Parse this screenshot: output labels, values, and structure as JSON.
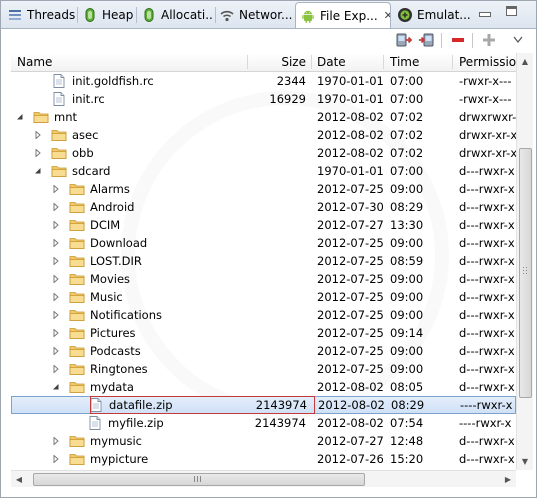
{
  "tabs": [
    {
      "label": "Threads",
      "icon": "threads-icon"
    },
    {
      "label": "Heap",
      "icon": "heap-icon"
    },
    {
      "label": "Allocati...",
      "icon": "allocation-tracker-icon"
    },
    {
      "label": "Networ...",
      "icon": "network-icon"
    },
    {
      "label": "File Exp...",
      "icon": "android-icon",
      "active": true,
      "close": "✕"
    },
    {
      "label": "Emulat...",
      "icon": "emulator-control-icon"
    }
  ],
  "toolbar": {
    "pull_file": "pull-file-icon",
    "push_file": "push-file-icon",
    "delete": "delete-icon",
    "new_folder": "new-folder-icon",
    "view_menu": "view-menu-icon"
  },
  "columns": {
    "name": "Name",
    "size": "Size",
    "date": "Date",
    "time": "Time",
    "permissions": "Permissio"
  },
  "rows": [
    {
      "level": 1,
      "type": "file",
      "expander": "",
      "name": "init.goldfish.rc",
      "size": "2344",
      "date": "1970-01-01",
      "time": "07:00",
      "perm": "-rwxr-x---"
    },
    {
      "level": 1,
      "type": "file",
      "expander": "",
      "name": "init.rc",
      "size": "16929",
      "date": "1970-01-01",
      "time": "07:00",
      "perm": "-rwxr-x---"
    },
    {
      "level": 0,
      "type": "folder",
      "expander": "expanded",
      "name": "mnt",
      "size": "",
      "date": "2012-08-02",
      "time": "07:02",
      "perm": "drwxrwxr-x"
    },
    {
      "level": 1,
      "type": "folder",
      "expander": "collapsed",
      "name": "asec",
      "size": "",
      "date": "2012-08-02",
      "time": "07:02",
      "perm": "drwxr-xr-x"
    },
    {
      "level": 1,
      "type": "folder",
      "expander": "collapsed",
      "name": "obb",
      "size": "",
      "date": "2012-08-02",
      "time": "07:02",
      "perm": "drwxr-xr-x"
    },
    {
      "level": 1,
      "type": "folder",
      "expander": "expanded",
      "name": "sdcard",
      "size": "",
      "date": "1970-01-01",
      "time": "07:00",
      "perm": "d---rwxr-x"
    },
    {
      "level": 2,
      "type": "folder",
      "expander": "collapsed",
      "name": "Alarms",
      "size": "",
      "date": "2012-07-25",
      "time": "09:00",
      "perm": "d---rwxr-x"
    },
    {
      "level": 2,
      "type": "folder",
      "expander": "collapsed",
      "name": "Android",
      "size": "",
      "date": "2012-07-30",
      "time": "08:29",
      "perm": "d---rwxr-x"
    },
    {
      "level": 2,
      "type": "folder",
      "expander": "collapsed",
      "name": "DCIM",
      "size": "",
      "date": "2012-07-27",
      "time": "13:30",
      "perm": "d---rwxr-x"
    },
    {
      "level": 2,
      "type": "folder",
      "expander": "collapsed",
      "name": "Download",
      "size": "",
      "date": "2012-07-25",
      "time": "09:00",
      "perm": "d---rwxr-x"
    },
    {
      "level": 2,
      "type": "folder",
      "expander": "collapsed",
      "name": "LOST.DIR",
      "size": "",
      "date": "2012-07-25",
      "time": "08:59",
      "perm": "d---rwxr-x"
    },
    {
      "level": 2,
      "type": "folder",
      "expander": "collapsed",
      "name": "Movies",
      "size": "",
      "date": "2012-07-25",
      "time": "09:00",
      "perm": "d---rwxr-x"
    },
    {
      "level": 2,
      "type": "folder",
      "expander": "collapsed",
      "name": "Music",
      "size": "",
      "date": "2012-07-25",
      "time": "09:00",
      "perm": "d---rwxr-x"
    },
    {
      "level": 2,
      "type": "folder",
      "expander": "collapsed",
      "name": "Notifications",
      "size": "",
      "date": "2012-07-25",
      "time": "09:00",
      "perm": "d---rwxr-x"
    },
    {
      "level": 2,
      "type": "folder",
      "expander": "collapsed",
      "name": "Pictures",
      "size": "",
      "date": "2012-07-25",
      "time": "09:14",
      "perm": "d---rwxr-x"
    },
    {
      "level": 2,
      "type": "folder",
      "expander": "collapsed",
      "name": "Podcasts",
      "size": "",
      "date": "2012-07-25",
      "time": "09:00",
      "perm": "d---rwxr-x"
    },
    {
      "level": 2,
      "type": "folder",
      "expander": "collapsed",
      "name": "Ringtones",
      "size": "",
      "date": "2012-07-25",
      "time": "09:00",
      "perm": "d---rwxr-x"
    },
    {
      "level": 2,
      "type": "folder",
      "expander": "expanded",
      "name": "mydata",
      "size": "",
      "date": "2012-08-02",
      "time": "08:05",
      "perm": "d---rwxr-x"
    },
    {
      "level": 3,
      "type": "file",
      "expander": "",
      "name": "datafile.zip",
      "size": "2143974",
      "date": "2012-08-02",
      "time": "08:29",
      "perm": "----rwxr-x",
      "selected": true
    },
    {
      "level": 3,
      "type": "file",
      "expander": "",
      "name": "myfile.zip",
      "size": "2143974",
      "date": "2012-08-02",
      "time": "07:54",
      "perm": "----rwxr-x"
    },
    {
      "level": 2,
      "type": "folder",
      "expander": "collapsed",
      "name": "mymusic",
      "size": "",
      "date": "2012-07-27",
      "time": "12:48",
      "perm": "d---rwxr-x"
    },
    {
      "level": 2,
      "type": "folder",
      "expander": "collapsed",
      "name": "mypicture",
      "size": "",
      "date": "2012-07-26",
      "time": "15:20",
      "perm": "d---rwxr-x"
    }
  ]
}
